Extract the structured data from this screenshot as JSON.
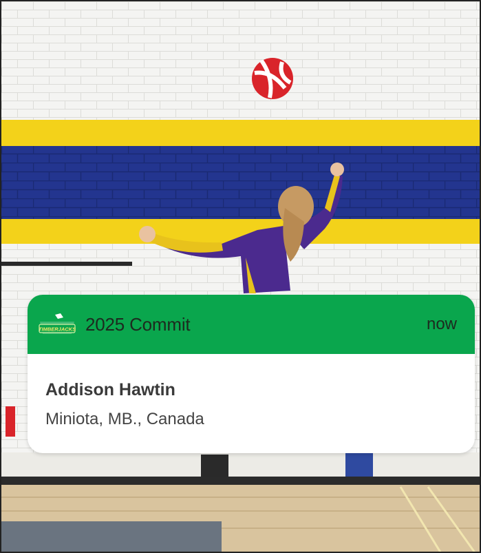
{
  "notification": {
    "category": "2025 Commit",
    "time": "now",
    "athlete_name": "Addison Hawtin",
    "location": "Miniota, MB., Canada",
    "logo_text": "TIMBERJACKS"
  },
  "colors": {
    "header_green": "#0aa64d",
    "wall_yellow": "#f5d417",
    "wall_blue": "#22348d",
    "jersey_purple": "#4a2a8c",
    "ball_red": "#d9242a"
  },
  "icons": {
    "logo": "team-logo-icon"
  }
}
